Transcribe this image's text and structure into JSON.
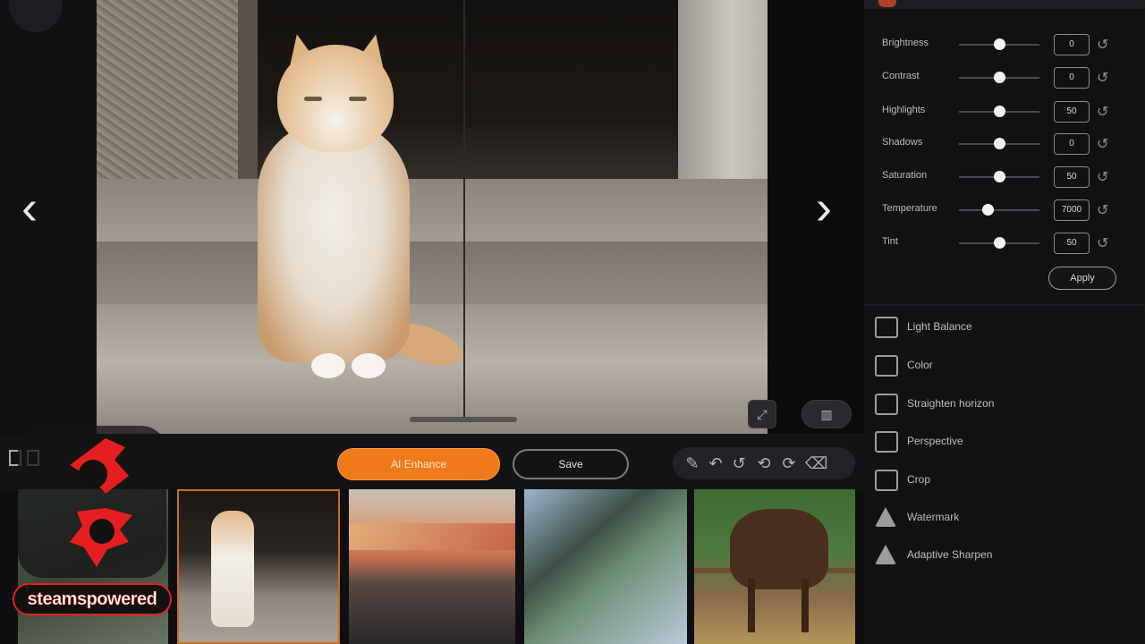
{
  "viewer": {
    "prev_arrow": "‹",
    "next_arrow": "›"
  },
  "adjustments": [
    {
      "label": "Brightness",
      "value": "0",
      "level": 0.5
    },
    {
      "label": "Contrast",
      "value": "0",
      "level": 0.5
    },
    {
      "label": "Highlights",
      "value": "50",
      "level": 0.5
    },
    {
      "label": "Shadows",
      "value": "0",
      "level": 0.5
    },
    {
      "label": "Saturation",
      "value": "50",
      "level": 0.5
    },
    {
      "label": "Temperature",
      "value": "7000",
      "level": 0.35
    },
    {
      "label": "Tint",
      "value": "50",
      "level": 0.5
    }
  ],
  "apply_label": "Apply",
  "tools": [
    {
      "label": "Light Balance",
      "icon": "light-balance-icon"
    },
    {
      "label": "Color",
      "icon": "color-icon"
    },
    {
      "label": "Straighten horizon",
      "icon": "straighten-icon"
    },
    {
      "label": "Perspective",
      "icon": "perspective-icon"
    },
    {
      "label": "Crop",
      "icon": "crop-icon"
    },
    {
      "label": "Watermark",
      "icon": "watermark-icon"
    },
    {
      "label": "Adaptive Sharpen",
      "icon": "sharpen-icon"
    }
  ],
  "toolbar": {
    "primary_label": "AI Enhance",
    "secondary_label": "Save"
  },
  "logo": {
    "brand_text": "steamspowered"
  },
  "colors": {
    "accent": "#f07a1a",
    "brand_red": "#e51f1f",
    "panel_bg": "#111214"
  }
}
